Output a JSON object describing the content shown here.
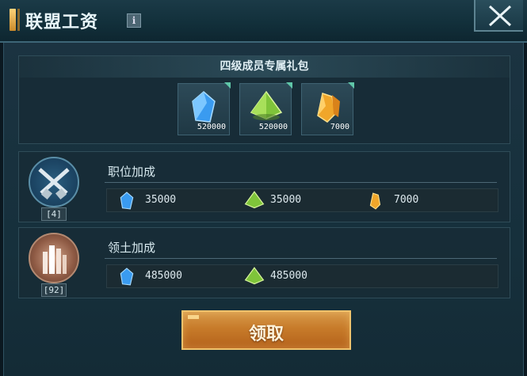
{
  "window": {
    "title": "联盟工资",
    "info_icon": "i"
  },
  "gift": {
    "title": "四级成员专属礼包",
    "items": [
      {
        "icon": "blue-crystal-icon",
        "count": "520000"
      },
      {
        "icon": "green-pyramid-icon",
        "count": "520000"
      },
      {
        "icon": "orange-crystal-icon",
        "count": "7000"
      }
    ]
  },
  "position_bonus": {
    "title": "职位加成",
    "level": "[4]",
    "emblem": "crossed-guns-icon",
    "resources": [
      {
        "icon": "blue-crystal-icon",
        "value": "35000"
      },
      {
        "icon": "green-pyramid-icon",
        "value": "35000"
      },
      {
        "icon": "orange-crystal-icon",
        "value": "7000"
      }
    ]
  },
  "territory_bonus": {
    "title": "领土加成",
    "level": "[92]",
    "emblem": "city-dome-icon",
    "resources": [
      {
        "icon": "blue-crystal-icon",
        "value": "485000"
      },
      {
        "icon": "green-pyramid-icon",
        "value": "485000"
      }
    ]
  },
  "claim_button": {
    "label": "领取"
  },
  "colors": {
    "accent_gold": "#f1c36c",
    "panel": "#16303c",
    "header": "#1b3a47"
  }
}
